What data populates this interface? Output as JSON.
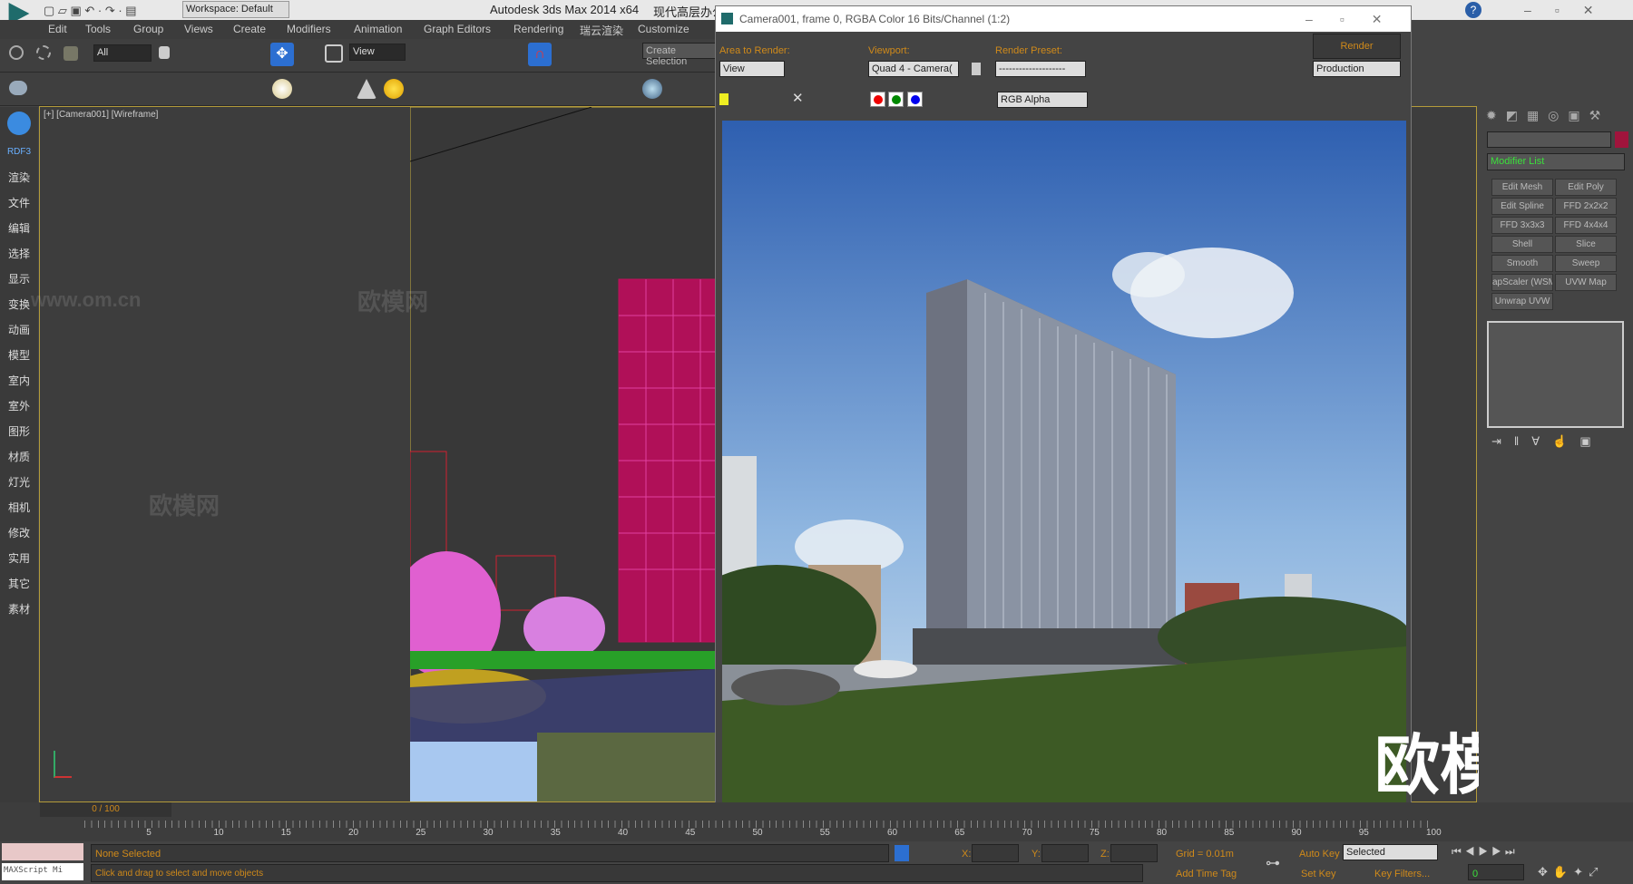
{
  "app": {
    "title": "Autodesk 3ds Max  2014 x64",
    "file_title": "现代高层办公",
    "workspace": "Workspace: Default"
  },
  "menu": [
    "Edit",
    "Tools",
    "Group",
    "Views",
    "Create",
    "Modifiers",
    "Animation",
    "Graph Editors",
    "Rendering",
    "瑞云渲染",
    "Customize"
  ],
  "toolbar": {
    "filter": "All",
    "ref_coord": "View",
    "selection_set": "Create Selection"
  },
  "sidebar": {
    "logo": "RDF3",
    "items": [
      "渲染",
      "文件",
      "编辑",
      "选择",
      "显示",
      "变换",
      "动画",
      "模型",
      "室内",
      "室外",
      "图形",
      "材质",
      "灯光",
      "相机",
      "修改",
      "实用",
      "其它",
      "素材"
    ]
  },
  "viewport": {
    "label": "[+] [Camera001] [Wireframe]"
  },
  "watermarks": [
    "欧模网",
    "www.om.cn"
  ],
  "render_window": {
    "title": "Camera001, frame 0, RGBA Color 16 Bits/Channel (1:2)",
    "area_label": "Area to Render:",
    "area_value": "View",
    "viewport_label": "Viewport:",
    "viewport_value": "Quad 4 - Camera(",
    "preset_label": "Render Preset:",
    "preset_value": "--------------------",
    "render_button": "Render",
    "render_mode": "Production",
    "channel": "RGB Alpha",
    "logo_text": "欧模网"
  },
  "command_panel": {
    "modifier_list": "Modifier List",
    "modifiers": [
      "Edit Mesh",
      "Edit Poly",
      "Edit Spline",
      "FFD 2x2x2",
      "FFD 3x3x3",
      "FFD 4x4x4",
      "Shell",
      "Slice",
      "Smooth",
      "Sweep",
      "apScaler (WSM",
      "UVW Map",
      "Unwrap UVW"
    ],
    "color": "#a0143c"
  },
  "timeline": {
    "frame": "0 / 100",
    "ticks": [
      "5",
      "10",
      "15",
      "20",
      "25",
      "30",
      "35",
      "40",
      "45",
      "50",
      "55",
      "60",
      "65",
      "70",
      "75",
      "80",
      "85",
      "90",
      "95",
      "100"
    ]
  },
  "status": {
    "maxscript": "MAXScript Mi",
    "selection": "None Selected",
    "prompt": "Click and drag to select and move objects",
    "x_label": "X:",
    "y_label": "Y:",
    "z_label": "Z:",
    "grid": "Grid = 0.01m",
    "add_time_tag": "Add Time Tag",
    "auto_key": "Auto Key",
    "set_key": "Set Key",
    "key_mode": "Selected",
    "key_filters": "Key Filters...",
    "frame_value": "0"
  }
}
